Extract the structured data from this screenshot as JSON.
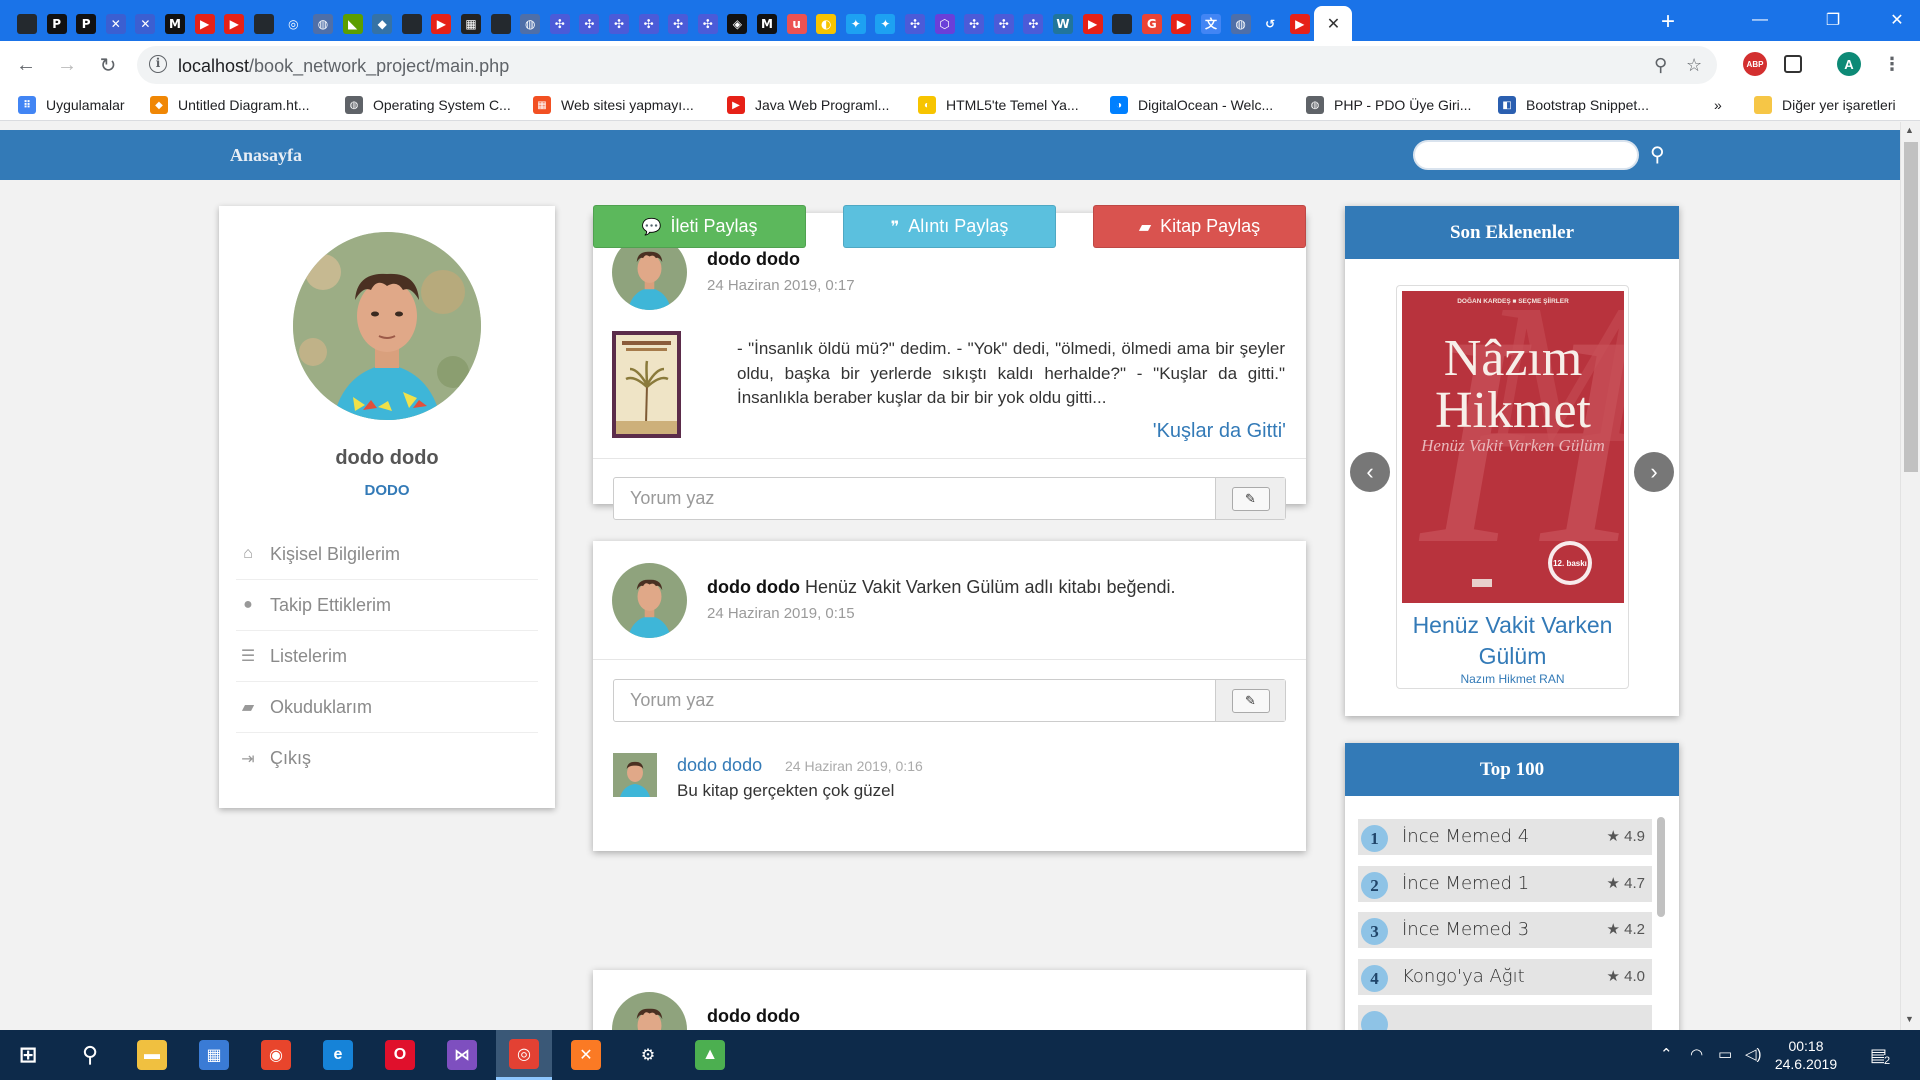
{
  "browser": {
    "tabs": [
      {
        "icon": "github-icon",
        "glyph": "",
        "color": "#24292e"
      },
      {
        "icon": "p-icon",
        "glyph": "P",
        "color": "#111"
      },
      {
        "icon": "p-icon",
        "glyph": "P",
        "color": "#111"
      },
      {
        "icon": "bolt-icon",
        "glyph": "✕",
        "color": "#3b5fd1"
      },
      {
        "icon": "bolt-icon",
        "glyph": "✕",
        "color": "#3b5fd1"
      },
      {
        "icon": "medium-icon",
        "glyph": "M",
        "color": "#111"
      },
      {
        "icon": "youtube-icon",
        "glyph": "▶",
        "color": "#e62117"
      },
      {
        "icon": "youtube-icon",
        "glyph": "▶",
        "color": "#e62117"
      },
      {
        "icon": "github-icon",
        "glyph": "",
        "color": "#24292e"
      },
      {
        "icon": "circle-icon",
        "glyph": "◎",
        "color": "#1a73e8"
      },
      {
        "icon": "globe-icon",
        "glyph": "◍",
        "color": "#4f6fa8"
      },
      {
        "icon": "nvidia-icon",
        "glyph": "◣",
        "color": "#5c9e00"
      },
      {
        "icon": "python-icon",
        "glyph": "◆",
        "color": "#3572a5"
      },
      {
        "icon": "github-icon",
        "glyph": "",
        "color": "#24292e"
      },
      {
        "icon": "youtube-icon",
        "glyph": "▶",
        "color": "#e62117"
      },
      {
        "icon": "image-icon",
        "glyph": "▦",
        "color": "#222"
      },
      {
        "icon": "github-icon",
        "glyph": "",
        "color": "#24292e"
      },
      {
        "icon": "globe-icon",
        "glyph": "◍",
        "color": "#4f6fa8"
      },
      {
        "icon": "atom-icon",
        "glyph": "✣",
        "color": "#4b5bd8"
      },
      {
        "icon": "atom-icon",
        "glyph": "✣",
        "color": "#4b5bd8"
      },
      {
        "icon": "atom-icon",
        "glyph": "✣",
        "color": "#4b5bd8"
      },
      {
        "icon": "atom-icon",
        "glyph": "✣",
        "color": "#4b5bd8"
      },
      {
        "icon": "atom-icon",
        "glyph": "✣",
        "color": "#4b5bd8"
      },
      {
        "icon": "atom-icon",
        "glyph": "✣",
        "color": "#4b5bd8"
      },
      {
        "icon": "codepen-icon",
        "glyph": "◈",
        "color": "#111"
      },
      {
        "icon": "medium-icon",
        "glyph": "M",
        "color": "#111"
      },
      {
        "icon": "udemy-icon",
        "glyph": "u",
        "color": "#ec5252"
      },
      {
        "icon": "turkcell-icon",
        "glyph": "◐",
        "color": "#f7c400"
      },
      {
        "icon": "twitter-icon",
        "glyph": "✦",
        "color": "#1da1f2"
      },
      {
        "icon": "twitter-icon",
        "glyph": "✦",
        "color": "#1da1f2"
      },
      {
        "icon": "atom-icon",
        "glyph": "✣",
        "color": "#4b5bd8"
      },
      {
        "icon": "hex-icon",
        "glyph": "⬡",
        "color": "#6a3fd8"
      },
      {
        "icon": "atom-icon",
        "glyph": "✣",
        "color": "#4b5bd8"
      },
      {
        "icon": "atom-icon",
        "glyph": "✣",
        "color": "#4b5bd8"
      },
      {
        "icon": "atom-icon",
        "glyph": "✣",
        "color": "#4b5bd8"
      },
      {
        "icon": "wordpress-icon",
        "glyph": "W",
        "color": "#21759b"
      },
      {
        "icon": "youtube-icon",
        "glyph": "▶",
        "color": "#e62117"
      },
      {
        "icon": "github-icon",
        "glyph": "",
        "color": "#24292e"
      },
      {
        "icon": "google-icon",
        "glyph": "G",
        "color": "#ea4335"
      },
      {
        "icon": "youtube-icon",
        "glyph": "▶",
        "color": "#e62117"
      },
      {
        "icon": "translate-icon",
        "glyph": "文",
        "color": "#4285f4"
      },
      {
        "icon": "globe-icon",
        "glyph": "◍",
        "color": "#4f6fa8"
      },
      {
        "icon": "history-icon",
        "glyph": "↺",
        "color": "#1a73e8"
      },
      {
        "icon": "youtube-icon",
        "glyph": "▶",
        "color": "#e62117"
      }
    ],
    "active_tab_close": "✕",
    "new_tab": "+",
    "url_host": "localhost",
    "url_path": "/book_network_project/main.php",
    "profile_initial": "A",
    "abp_label": "ABP",
    "bookmarks": [
      {
        "label": "Uygulamalar",
        "icon": "apps-grid-icon",
        "color": "#4285f4",
        "glyph": "⠿"
      },
      {
        "label": "Untitled Diagram.ht...",
        "icon": "drawio-icon",
        "color": "#f08705",
        "glyph": "◆"
      },
      {
        "label": "Operating System C...",
        "icon": "globe-icon",
        "color": "#5f6368",
        "glyph": "◍"
      },
      {
        "label": "Web sitesi yapmayı...",
        "icon": "microsoft-icon",
        "color": "#f25022",
        "glyph": "▦"
      },
      {
        "label": "Java Web Programl...",
        "icon": "youtube-icon",
        "color": "#e62117",
        "glyph": "▶"
      },
      {
        "label": "HTML5'te Temel Ya...",
        "icon": "turkcell-icon",
        "color": "#f7c400",
        "glyph": "◐"
      },
      {
        "label": "DigitalOcean - Welc...",
        "icon": "digitalocean-icon",
        "color": "#0080ff",
        "glyph": "◑"
      },
      {
        "label": "PHP - PDO Üye Giri...",
        "icon": "globe-icon",
        "color": "#5f6368",
        "glyph": "◍"
      },
      {
        "label": "Bootstrap Snippet...",
        "icon": "bootstrap-icon",
        "color": "#2b5fb0",
        "glyph": "◧"
      }
    ],
    "bookmarks_more": "»",
    "other_bookmarks": "Diğer yer işaretleri"
  },
  "site": {
    "brand": "Anasayfa",
    "search_placeholder": "",
    "profile": {
      "name": "dodo dodo",
      "username": "DODO",
      "menu": [
        {
          "label": "Kişisel Bilgilerim",
          "icon": "home-icon",
          "glyph": "⌂"
        },
        {
          "label": "Takip Ettiklerim",
          "icon": "user-icon",
          "glyph": "●"
        },
        {
          "label": "Listelerim",
          "icon": "list-icon",
          "glyph": "☰"
        },
        {
          "label": "Okuduklarım",
          "icon": "book-icon",
          "glyph": "▰"
        },
        {
          "label": "Çıkış",
          "icon": "sign-out-icon",
          "glyph": "⇥"
        }
      ]
    },
    "actions": [
      {
        "label": "İleti Paylaş",
        "icon": "comments-icon",
        "glyph": "💬",
        "color": "#5cb85c"
      },
      {
        "label": "Alıntı Paylaş",
        "icon": "quote-icon",
        "glyph": "❞",
        "color": "#5bc0de"
      },
      {
        "label": "Kitap Paylaş",
        "icon": "book-icon",
        "glyph": "▰",
        "color": "#d9534f"
      }
    ],
    "posts": [
      {
        "author": "dodo dodo",
        "time": "24 Haziran 2019, 0:17",
        "quote": "- \"İnsanlık öldü mü?\" dedim. - \"Yok\" dedi, \"ölmedi, ölmedi ama bir şeyler oldu, başka bir yerlerde sıkıştı kaldı herhalde?\" - \"Kuşlar da gitti.\" İnsanlıkla beraber kuşlar da bir bir yok oldu gitti...",
        "quote_source": "'Kuşlar da Gitti'",
        "comment_placeholder": "Yorum yaz"
      },
      {
        "author": "dodo dodo",
        "book": "Henüz Vakit Varken Gülüm",
        "action": "adlı kitabı beğendi.",
        "time": "24 Haziran 2019, 0:15",
        "comment_placeholder": "Yorum yaz",
        "comment": {
          "author": "dodo dodo",
          "time": "24 Haziran 2019, 0:16",
          "text": "Bu kitap gerçekten çok güzel"
        }
      },
      {
        "author": "dodo dodo"
      }
    ],
    "recent": {
      "title": "Son Eklenenler",
      "book_title": "Henüz Vakit Varken Gülüm",
      "book_author": "Nazım Hikmet RAN",
      "cover_top": "DOĞAN KARDEŞ  ■  SEÇME ŞİİRLER",
      "cover_name1": "Nâzım",
      "cover_name2": "Hikmet",
      "cover_subtitle": "Henüz Vakit Varken Gülüm",
      "cover_badge": "12. baskı",
      "prev": "‹",
      "next": "›"
    },
    "top100": {
      "title": "Top 100",
      "items": [
        {
          "rank": "1",
          "name": "İnce Memed 4",
          "rating": "4.9"
        },
        {
          "rank": "2",
          "name": "İnce Memed 1",
          "rating": "4.7"
        },
        {
          "rank": "3",
          "name": "İnce Memed 3",
          "rating": "4.2"
        },
        {
          "rank": "4",
          "name": "Kongo'ya Ağıt",
          "rating": "4.0"
        }
      ],
      "star": "★"
    }
  },
  "taskbar": {
    "apps": [
      {
        "icon": "windows-start-icon",
        "glyph": "⊞",
        "color": "transparent"
      },
      {
        "icon": "search-icon",
        "glyph": "⚲",
        "color": "transparent"
      },
      {
        "icon": "file-explorer-icon",
        "glyph": "▬",
        "color": "#f0c040"
      },
      {
        "icon": "store-icon",
        "glyph": "▦",
        "color": "#3a7bd5"
      },
      {
        "icon": "screen-recorder-icon",
        "glyph": "◉",
        "color": "#e8452c"
      },
      {
        "icon": "edge-icon",
        "glyph": "e",
        "color": "#1683d8"
      },
      {
        "icon": "opera-icon",
        "glyph": "O",
        "color": "#e0102c"
      },
      {
        "icon": "visual-studio-icon",
        "glyph": "⋈",
        "color": "#7e4fbf"
      },
      {
        "icon": "chrome-icon",
        "glyph": "◎",
        "color": "#e34133"
      },
      {
        "icon": "xampp-icon",
        "glyph": "✕",
        "color": "#fb7a24"
      },
      {
        "icon": "settings-icon",
        "glyph": "⚙",
        "color": "transparent"
      },
      {
        "icon": "image-editor-icon",
        "glyph": "▲",
        "color": "#4caf50"
      }
    ],
    "time": "00:18",
    "date": "24.6.2019",
    "notifications": "2"
  }
}
